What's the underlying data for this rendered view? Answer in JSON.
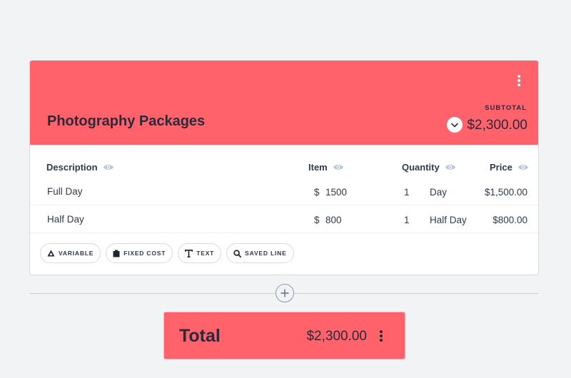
{
  "colors": {
    "accent": "#ff626b"
  },
  "section": {
    "title": "Photography Packages",
    "subtotal_label": "SUBTOTAL",
    "subtotal_value": "$2,300.00"
  },
  "columns": {
    "description": "Description",
    "item": "Item",
    "quantity": "Quantity",
    "price": "Price"
  },
  "rows": [
    {
      "description": "Full Day",
      "currency": "$",
      "item": "1500",
      "quantity": "1",
      "unit": "Day",
      "price": "$1,500.00"
    },
    {
      "description": "Half Day",
      "currency": "$",
      "item": "800",
      "quantity": "1",
      "unit": "Half Day",
      "price": "$800.00"
    }
  ],
  "add_options": [
    {
      "label": "VARIABLE",
      "icon": "triangle-icon"
    },
    {
      "label": "FIXED COST",
      "icon": "block-icon"
    },
    {
      "label": "TEXT",
      "icon": "text-icon"
    },
    {
      "label": "SAVED LINE",
      "icon": "search-icon"
    }
  ],
  "total": {
    "label": "Total",
    "value": "$2,300.00"
  }
}
